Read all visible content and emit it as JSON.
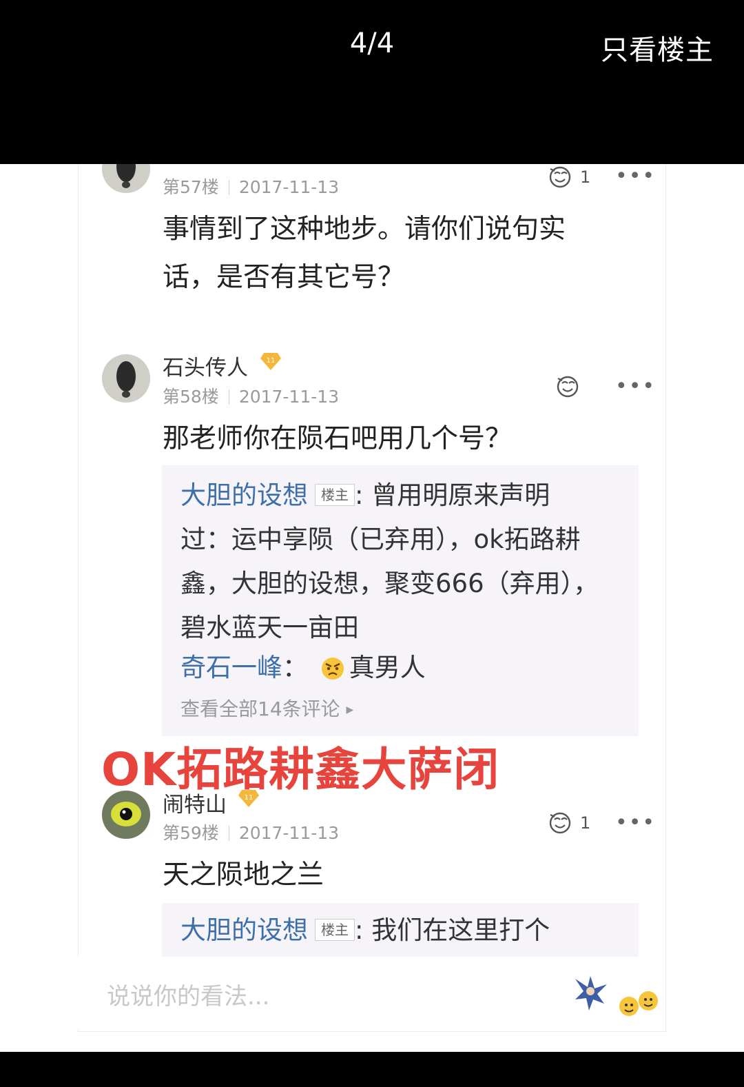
{
  "topbar": {
    "page_counter": "4/4",
    "only_op_label": "只看楼主"
  },
  "posts": [
    {
      "floor": "第57楼",
      "date": "2017-11-13",
      "likes": "1",
      "content_lines": [
        "事情到了这种地步。请你们说句实",
        "话，是否有其它号？"
      ]
    },
    {
      "username": "石头传人",
      "floor": "第58楼",
      "date": "2017-11-13",
      "content": "那老师你在陨石吧用几个号？",
      "replies": [
        {
          "user": "大胆的设想",
          "tag": "楼主",
          "sep": ": ",
          "lines": [
            "曾用明原来声明",
            "过：运中享陨（已弃用），ok拓路耕",
            "鑫，大胆的设想，聚变666（弃用），",
            "碧水蓝天一亩田"
          ]
        },
        {
          "user": "奇石一峰",
          "sep": "：",
          "text": "真男人"
        }
      ],
      "view_all": "查看全部14条评论"
    },
    {
      "username": "闹特山",
      "floor": "第59楼",
      "date": "2017-11-13",
      "likes": "1",
      "content": "天之陨地之兰",
      "replies": [
        {
          "user": "大胆的设想",
          "tag": "楼主",
          "sep": ": ",
          "text": "我们在这里打个"
        }
      ]
    }
  ],
  "watermark": "OK拓路耕鑫大萨闭",
  "input": {
    "placeholder": "说说你的看法..."
  },
  "icons": {
    "like": "like-face-icon",
    "more": "more-dots-icon",
    "level": "level-11-diamond-badge-icon"
  },
  "colors": {
    "reply_user": "#3d6fa8",
    "watermark": "#e6443c",
    "quote_bg": "#f6f4f9"
  }
}
